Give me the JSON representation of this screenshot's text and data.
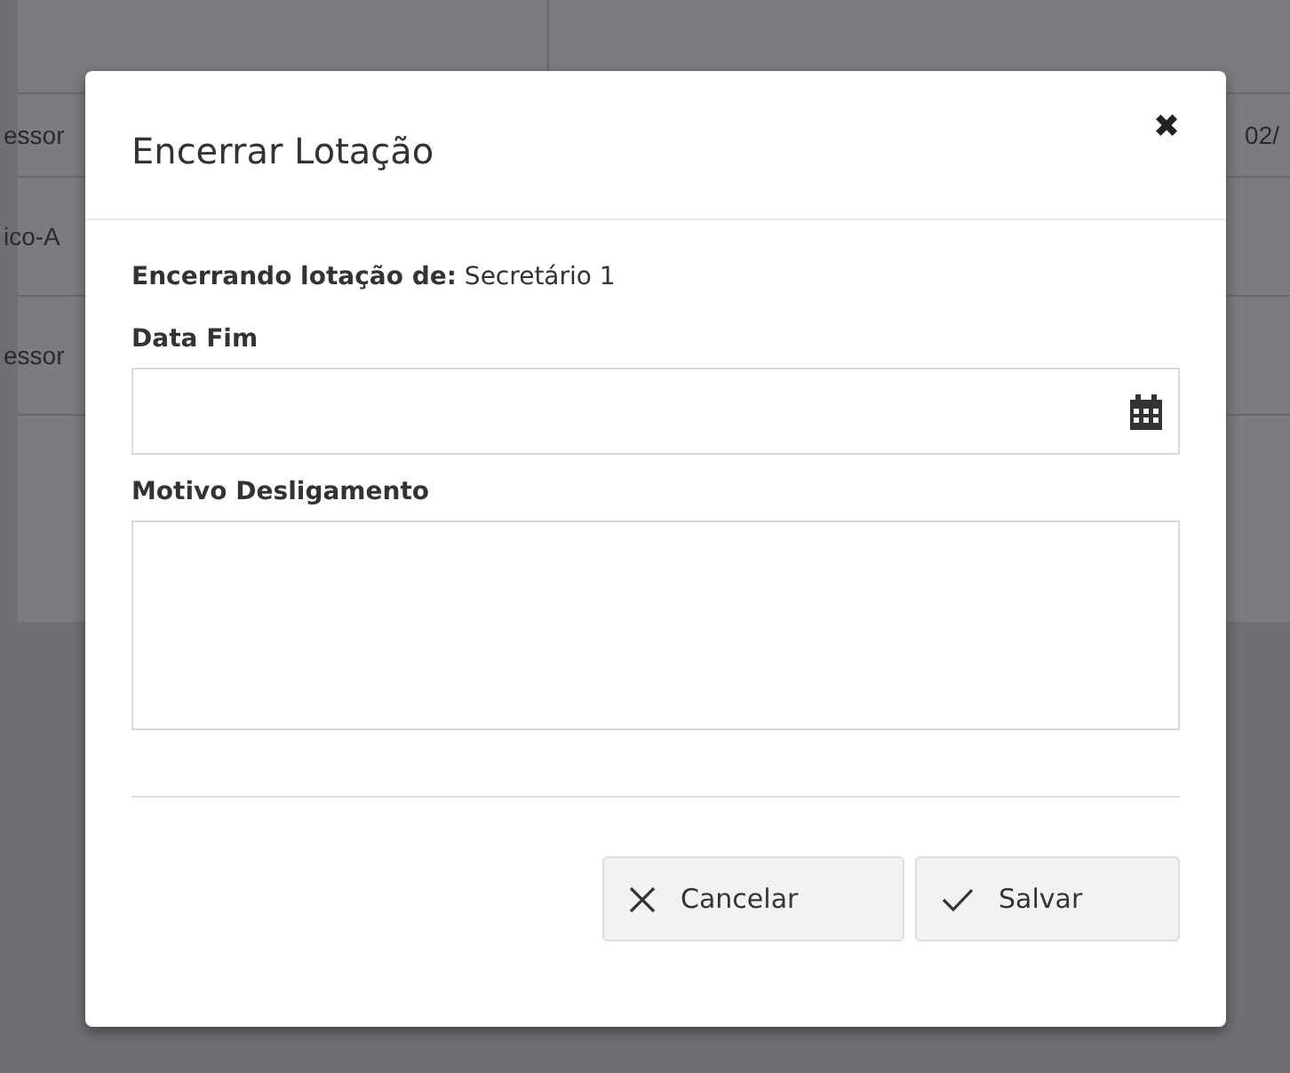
{
  "background_table": {
    "rows": [
      {
        "column_1": "essor",
        "column_2": "02/"
      },
      {
        "column_1": "ico-A"
      },
      {
        "column_1": "essor"
      }
    ]
  },
  "dialog": {
    "title": "Encerrar Lotação",
    "close": "✖",
    "intro": "**Encerrando lotação de:** Secretário 1",
    "fields": [
      {
        "kind": "date",
        "label": "Data Fim"
      },
      {
        "kind": "textarea",
        "label": "Motivo Desligamento"
      }
    ],
    "buttons": [
      {
        "kind": "cancel",
        "label": "Cancelar"
      },
      {
        "kind": "save",
        "label": "Salvar"
      }
    ]
  }
}
